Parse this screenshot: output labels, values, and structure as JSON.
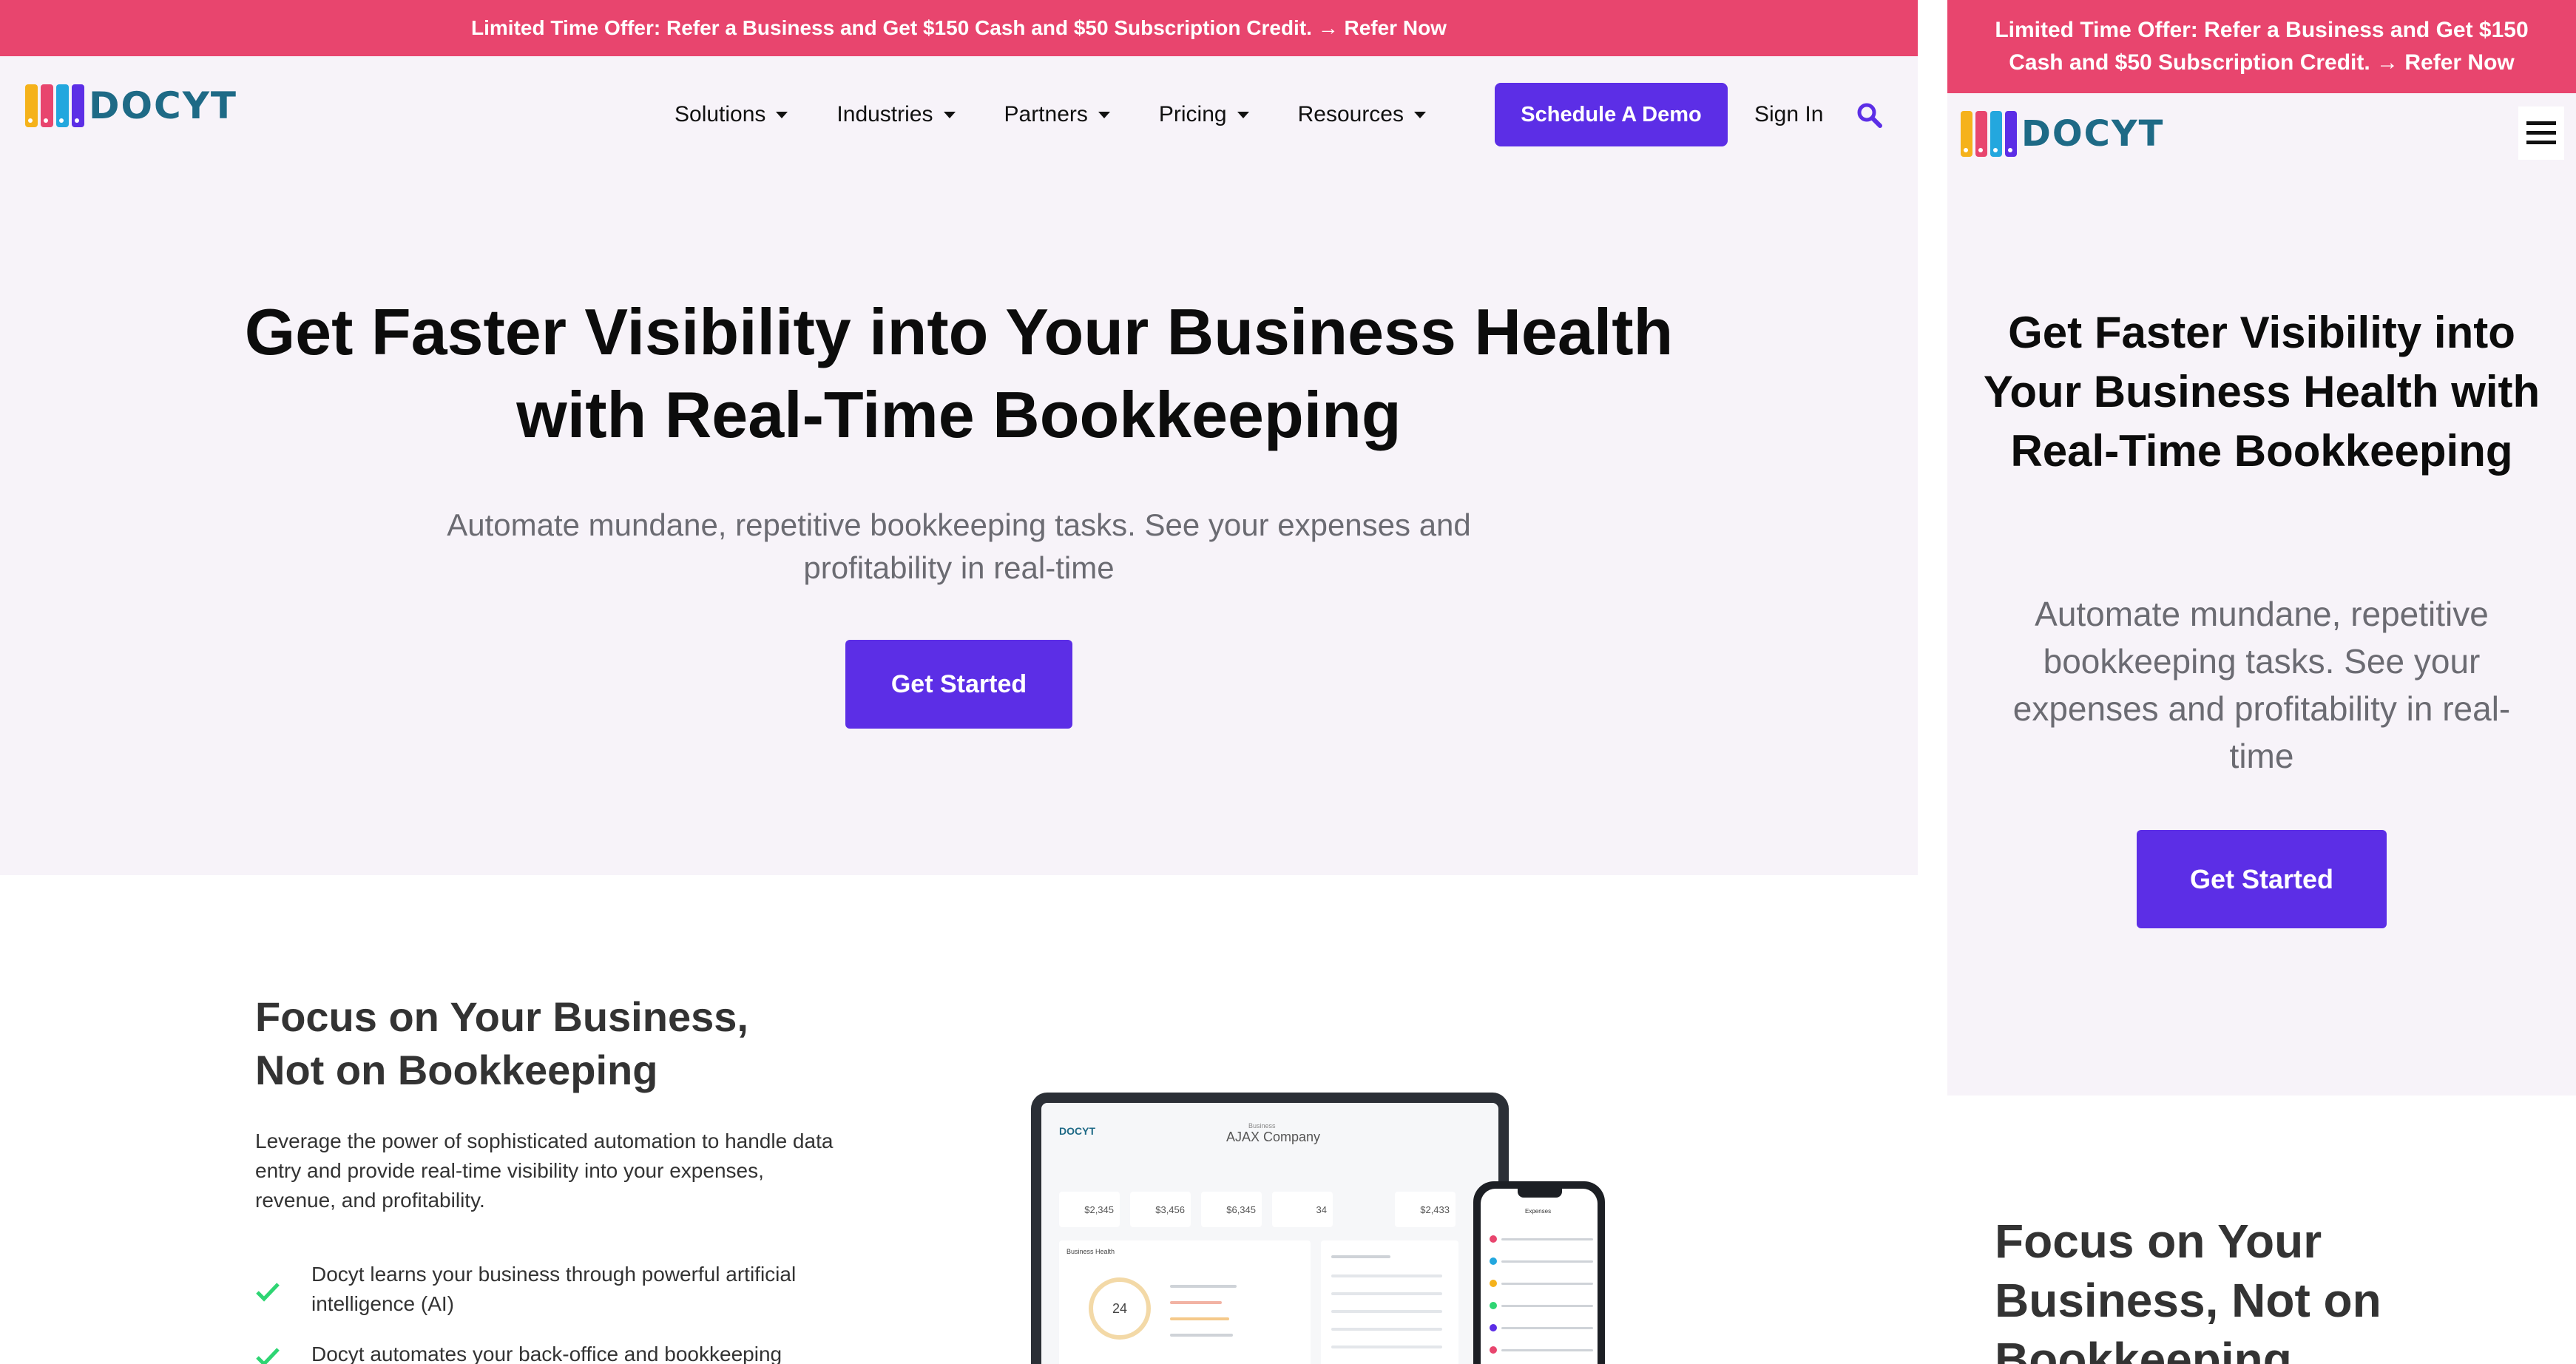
{
  "promo_banner": "Limited Time Offer: Refer a Business and Get $150 Cash and $50 Subscription Credit. → Refer Now",
  "brand": {
    "wordmark": "DOCYT",
    "logo_colors": [
      "#f5b21b",
      "#e8456e",
      "#23a7de",
      "#5c2ee6"
    ],
    "accent": "#5c2ee6",
    "banner_color": "#e8456e"
  },
  "nav": {
    "items": [
      {
        "label": "Solutions"
      },
      {
        "label": "Industries"
      },
      {
        "label": "Partners"
      },
      {
        "label": "Pricing"
      },
      {
        "label": "Resources"
      }
    ],
    "demo_button": "Schedule A Demo",
    "sign_in": "Sign In",
    "search_icon": "search-icon"
  },
  "hero": {
    "title": "Get Faster Visibility into Your Business Health with Real-Time Bookkeeping",
    "subtitle": "Automate mundane, repetitive bookkeeping tasks. See your expenses and profitability in real-time",
    "cta": "Get Started"
  },
  "focus": {
    "title": "Focus on Your Business, Not on Bookkeeping",
    "body": "Leverage the power of sophisticated automation to handle data entry and provide real-time visibility into your expenses, revenue, and profitability.",
    "bullets": [
      "Docyt learns your business through powerful artificial intelligence (AI)",
      "Docyt automates your back-office and bookkeeping"
    ]
  },
  "device_mock": {
    "company_label": "Business",
    "company": "AJAX Company",
    "stats": [
      "$2,345",
      "$3,456",
      "$6,345",
      "34",
      "$2,433"
    ],
    "panel_label": "Business Health",
    "ring_value": "24",
    "phone_title": "Expenses"
  },
  "mobile": {
    "menu_icon": "hamburger-icon"
  }
}
